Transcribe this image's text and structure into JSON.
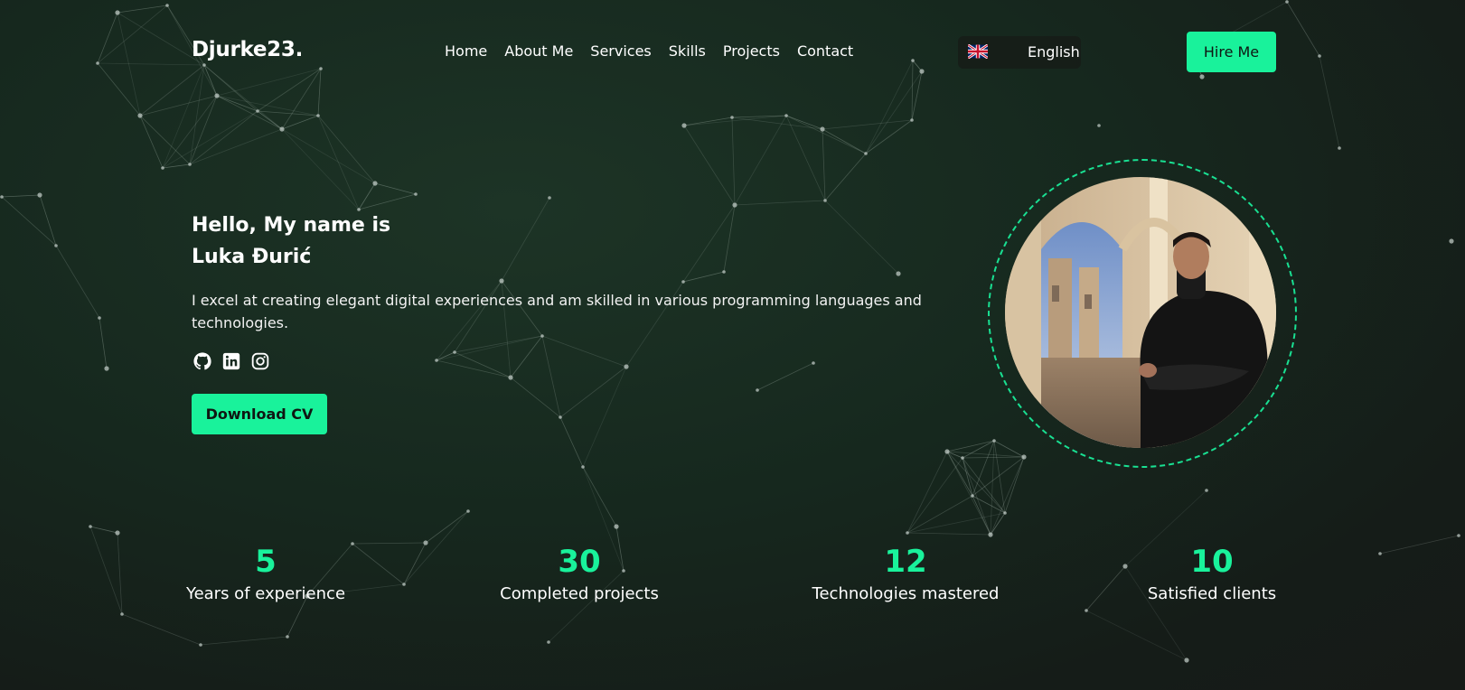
{
  "header": {
    "logo": "Djurke23.",
    "nav": [
      "Home",
      "About Me",
      "Services",
      "Skills",
      "Projects",
      "Contact"
    ],
    "language": {
      "flag": "uk-flag-icon",
      "label": "English"
    },
    "hire_label": "Hire Me"
  },
  "hero": {
    "greeting_line1": "Hello, My name is",
    "greeting_line2": "Luka Đurić",
    "intro": "I excel at creating elegant digital experiences and am skilled in various programming languages and technologies.",
    "socials": [
      "github-icon",
      "linkedin-icon",
      "instagram-icon"
    ],
    "download_label": "Download CV"
  },
  "stats": [
    {
      "value": "5",
      "label": "Years of experience"
    },
    {
      "value": "30",
      "label": "Completed projects"
    },
    {
      "value": "12",
      "label": "Technologies mastered"
    },
    {
      "value": "10",
      "label": "Satisfied clients"
    }
  ],
  "colors": {
    "accent": "#19f29b",
    "background": "#172a20",
    "text": "#ffffff"
  }
}
